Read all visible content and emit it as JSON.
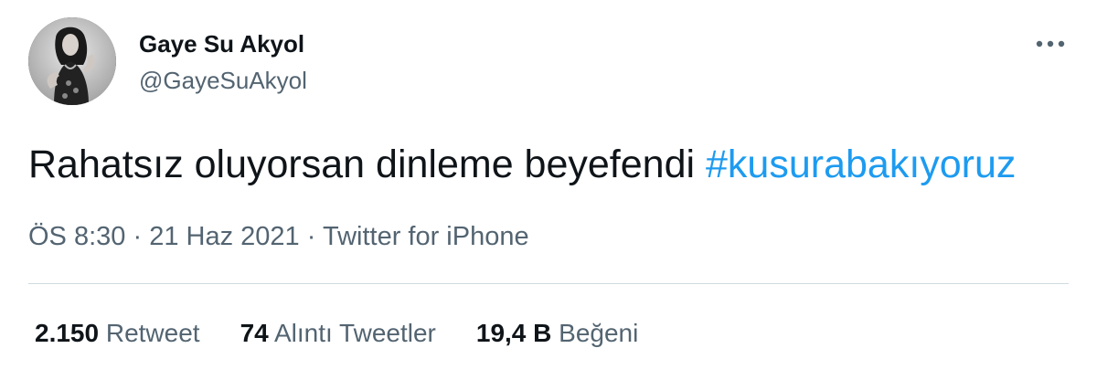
{
  "user": {
    "display_name": "Gaye Su Akyol",
    "handle": "@GayeSuAkyol",
    "avatar_icon": "profile-photo"
  },
  "tweet": {
    "text": "Rahatsız oluyorsan dinleme beyefendi",
    "hashtag": "#kusurabakıyoruz"
  },
  "meta": {
    "time": "ÖS 8:30",
    "separator1": "·",
    "date": "21 Haz 2021",
    "separator2": "·",
    "source": "Twitter for iPhone"
  },
  "stats": {
    "retweets": {
      "count": "2.150",
      "label": "Retweet"
    },
    "quotes": {
      "count": "74",
      "label": "Alıntı Tweetler"
    },
    "likes": {
      "count": "19,4 B",
      "label": "Beğeni"
    }
  },
  "more_icon": "more-dots-icon",
  "colors": {
    "hashtag": "#1d9bf0",
    "secondary_text": "#536471",
    "primary_text": "#0f1419",
    "divider": "#cfd9de"
  }
}
